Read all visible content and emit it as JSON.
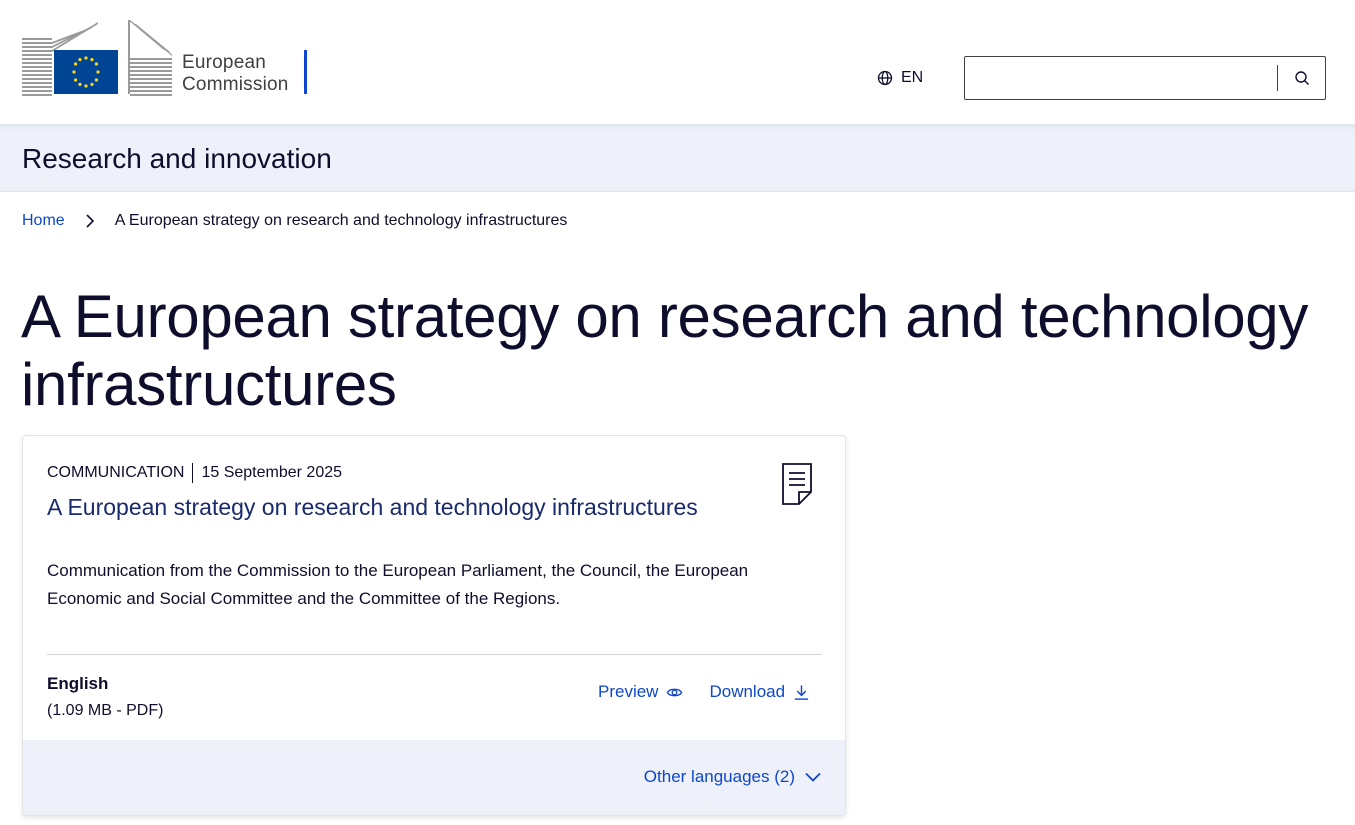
{
  "header": {
    "logo_line1": "European",
    "logo_line2": "Commission",
    "language_code": "EN",
    "search_placeholder": ""
  },
  "site": {
    "name": "Research and innovation"
  },
  "breadcrumb": {
    "home": "Home",
    "current": "A European strategy on research and technology infrastructures"
  },
  "page": {
    "title": "A European strategy on research and technology infrastructures"
  },
  "document": {
    "type": "COMMUNICATION",
    "date": "15 September 2025",
    "title": "A European strategy on research and technology infrastructures",
    "description": "Communication from the Commission to the European Parliament, the Council, the European Economic and Social Committee and the Committee of the Regions.",
    "language": "English",
    "file_info": "(1.09 MB - PDF)",
    "preview_label": "Preview",
    "download_label": "Download",
    "other_languages_label": "Other languages (2)"
  },
  "icons": {
    "globe": "globe-icon",
    "search": "search-icon",
    "chevron_right": "chevron-right-icon",
    "document": "document-icon",
    "eye": "eye-icon",
    "download": "download-icon",
    "chevron_down": "chevron-down-icon"
  },
  "colors": {
    "link": "#0e47cb",
    "text": "#0e0e2c",
    "band": "#eef1fa",
    "eu_blue": "#004494",
    "eu_yellow": "#ffd617"
  }
}
